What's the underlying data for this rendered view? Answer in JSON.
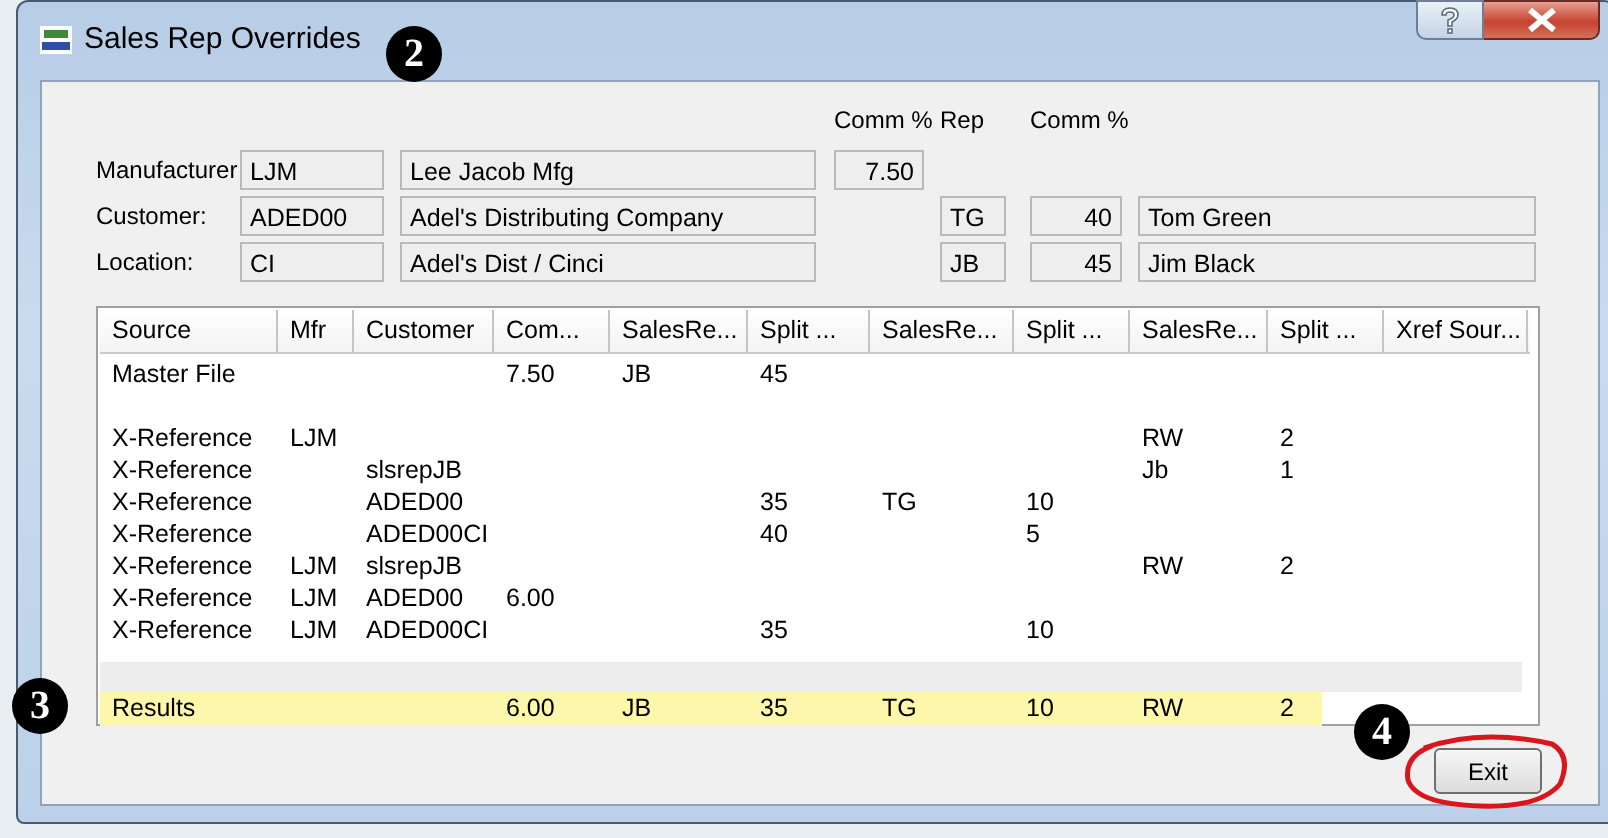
{
  "window": {
    "title": "Sales Rep Overrides"
  },
  "form_headings": [
    "Comm %",
    "Rep",
    "Comm %"
  ],
  "form": [
    {
      "label": "Manufacturer",
      "code": "LJM",
      "name": "Lee Jacob Mfg",
      "comm_pct": "7.50"
    },
    {
      "label": "Customer:",
      "code": "ADED00",
      "name": "Adel's Distributing Company",
      "rep": "TG",
      "rep_comm_pct": "40",
      "rep_name": "Tom Green"
    },
    {
      "label": "Location:",
      "code": "CI",
      "name": "Adel's Dist / Cinci",
      "rep": "JB",
      "rep_comm_pct": "45",
      "rep_name": "Jim Black"
    }
  ],
  "table": {
    "columns": [
      "Source",
      "Mfr",
      "Customer",
      "Com...",
      "SalesRe...",
      "Split ...",
      "SalesRe...",
      "Split ...",
      "SalesRe...",
      "Split ...",
      "Xref Sour..."
    ],
    "rows": [
      {
        "kind": "data",
        "cells": [
          "Master File",
          null,
          null,
          "7.50",
          "JB",
          "45",
          null,
          null,
          null,
          null,
          null
        ]
      },
      {
        "kind": "blank"
      },
      {
        "kind": "data",
        "cells": [
          "X-Reference",
          "LJM",
          null,
          null,
          null,
          null,
          null,
          null,
          "RW",
          "2",
          null
        ]
      },
      {
        "kind": "data",
        "cells": [
          "X-Reference",
          null,
          "slsrepJB",
          null,
          null,
          null,
          null,
          null,
          "Jb",
          "1",
          null
        ]
      },
      {
        "kind": "data",
        "cells": [
          "X-Reference",
          null,
          "ADED00",
          null,
          null,
          "35",
          "TG",
          "10",
          null,
          null,
          null
        ]
      },
      {
        "kind": "data",
        "cells": [
          "X-Reference",
          null,
          "ADED00CI",
          null,
          null,
          "40",
          null,
          "5",
          null,
          null,
          null
        ]
      },
      {
        "kind": "data",
        "cells": [
          "X-Reference",
          "LJM",
          "slsrepJB",
          null,
          null,
          null,
          null,
          null,
          "RW",
          "2",
          null
        ]
      },
      {
        "kind": "data",
        "cells": [
          "X-Reference",
          "LJM",
          "ADED00",
          "6.00",
          null,
          null,
          null,
          null,
          null,
          null,
          null
        ]
      },
      {
        "kind": "data",
        "cells": [
          "X-Reference",
          "LJM",
          "ADED00CI",
          null,
          null,
          "35",
          null,
          "10",
          null,
          null,
          null
        ]
      },
      {
        "kind": "separator"
      },
      {
        "kind": "result",
        "cells": [
          "Results",
          null,
          null,
          "6.00",
          "JB",
          "35",
          "TG",
          "10",
          "RW",
          "2",
          null
        ]
      }
    ]
  },
  "buttons": [
    "Exit"
  ],
  "annotations": [
    {
      "label": "2"
    },
    {
      "label": "3"
    },
    {
      "label": "4"
    }
  ]
}
